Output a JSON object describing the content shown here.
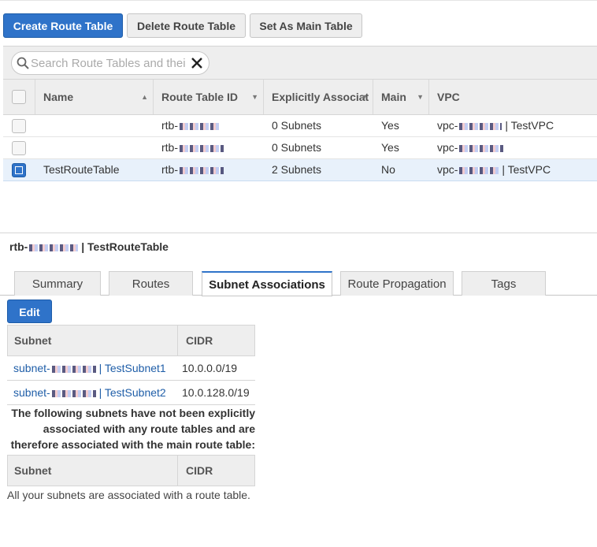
{
  "toolbar": {
    "create_label": "Create Route Table",
    "delete_label": "Delete Route Table",
    "main_label": "Set As Main Table"
  },
  "search": {
    "placeholder": "Search Route Tables and their",
    "value": ""
  },
  "grid": {
    "columns": [
      "Name",
      "Route Table ID",
      "Explicitly Associat",
      "Main",
      "VPC"
    ],
    "rows": [
      {
        "name": "",
        "id": "rtb-",
        "assoc": "0 Subnets",
        "main": "Yes",
        "vpc": "vpc-",
        "vpc_name": "| TestVPC",
        "selected": false
      },
      {
        "name": "",
        "id": "rtb-",
        "assoc": "0 Subnets",
        "main": "Yes",
        "vpc": "vpc-",
        "vpc_name": "",
        "selected": false
      },
      {
        "name": "TestRouteTable",
        "id": "rtb-",
        "assoc": "2 Subnets",
        "main": "No",
        "vpc": "vpc-",
        "vpc_name": "| TestVPC",
        "selected": true
      }
    ]
  },
  "detail": {
    "title_prefix": "rtb-",
    "title_suffix": "| TestRouteTable",
    "tabs": [
      "Summary",
      "Routes",
      "Subnet Associations",
      "Route Propagation",
      "Tags"
    ],
    "active_tab": "Subnet Associations",
    "edit_label": "Edit",
    "assoc_table": {
      "headers": [
        "Subnet",
        "CIDR"
      ],
      "rows": [
        {
          "subnet": "subnet-",
          "subnet_name": "| TestSubnet1",
          "cidr": "10.0.0.0/19"
        },
        {
          "subnet": "subnet-",
          "subnet_name": "| TestSubnet2",
          "cidr": "10.0.128.0/19"
        }
      ]
    },
    "note": "The following subnets have not been explicitly associated with any route tables and are therefore associated with the main route table:",
    "unassoc_table": {
      "headers": [
        "Subnet",
        "CIDR"
      ]
    },
    "empty_message": "All your subnets are associated with a route table."
  },
  "colors": {
    "primary": "#2f73c9",
    "selected_row": "#e8f1fb",
    "link": "#1f5ea8"
  },
  "icons": [
    "search-icon",
    "clear-icon",
    "sort-asc-icon",
    "sort-desc-icon"
  ]
}
